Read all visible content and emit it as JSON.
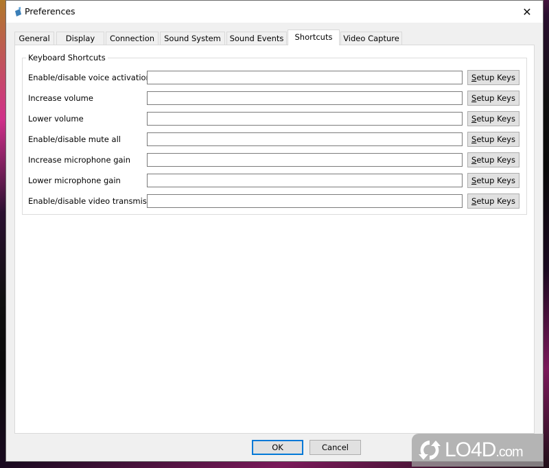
{
  "window": {
    "title": "Preferences",
    "close_glyph": "✕"
  },
  "tabs": [
    {
      "label": "General",
      "active": false
    },
    {
      "label": "Display",
      "active": false
    },
    {
      "label": "Connection",
      "active": false
    },
    {
      "label": "Sound System",
      "active": false
    },
    {
      "label": "Sound Events",
      "active": false
    },
    {
      "label": "Shortcuts",
      "active": true
    },
    {
      "label": "Video Capture",
      "active": false
    }
  ],
  "group": {
    "title": "Keyboard Shortcuts"
  },
  "shortcuts": [
    {
      "label": "Enable/disable voice activation",
      "value": "",
      "button": {
        "mnemonic": "S",
        "rest": "etup Keys"
      }
    },
    {
      "label": "Increase volume",
      "value": "",
      "button": {
        "mnemonic": "S",
        "rest": "etup Keys"
      }
    },
    {
      "label": "Lower volume",
      "value": "",
      "button": {
        "mnemonic": "S",
        "rest": "etup Keys"
      }
    },
    {
      "label": "Enable/disable mute all",
      "value": "",
      "button": {
        "mnemonic": "S",
        "rest": "etup Keys"
      }
    },
    {
      "label": "Increase microphone gain",
      "value": "",
      "button": {
        "mnemonic": "S",
        "rest": "etup Keys"
      }
    },
    {
      "label": "Lower microphone gain",
      "value": "",
      "button": {
        "mnemonic": "S",
        "rest": "etup Keys"
      }
    },
    {
      "label": "Enable/disable video transmission",
      "value": "",
      "button": {
        "mnemonic": "S",
        "rest": "etup Keys"
      }
    }
  ],
  "footer": {
    "ok_label": "OK",
    "cancel_label": "Cancel"
  },
  "watermark": {
    "brand": "LO4D",
    "suffix": ".com"
  },
  "colors": {
    "focus_border": "#0078d7",
    "button_bg": "#e1e1e1"
  }
}
